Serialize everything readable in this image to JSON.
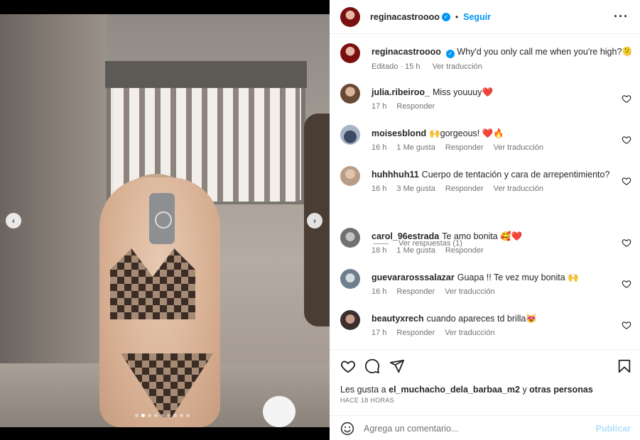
{
  "header": {
    "username": "reginacastroooo",
    "follow_label": "Seguir",
    "bullet": "•",
    "more_label": "•••"
  },
  "caption": {
    "username": "reginacastroooo",
    "text": "Why'd you only call me when you're high?🫠",
    "edited": "Editado",
    "time": "15 h",
    "translate": "Ver traducción"
  },
  "comments": [
    {
      "username": "julia.ribeiroo_",
      "text": "Miss youuuy❤️",
      "time": "17 h",
      "likes": "",
      "reply": "Responder",
      "translate": ""
    },
    {
      "username": "moisesblond",
      "text": "🙌gorgeous! ❤️🔥",
      "time": "16 h",
      "likes": "1 Me gusta",
      "reply": "Responder",
      "translate": "Ver traducción"
    },
    {
      "username": "huhhhuh11",
      "text": "Cuerpo de tentación y cara de arrepentimiento?",
      "time": "16 h",
      "likes": "3 Me gusta",
      "reply": "Responder",
      "translate": "Ver traducción"
    },
    {
      "username": "carol_96estrada",
      "text": "Te amo bonita 🥰❤️",
      "time": "18 h",
      "likes": "1 Me gusta",
      "reply": "Responder",
      "translate": ""
    },
    {
      "username": "guevararosssalazar",
      "text": "Guapa !! Te vez muy bonita 🙌",
      "time": "16 h",
      "likes": "",
      "reply": "Responder",
      "translate": "Ver traducción"
    },
    {
      "username": "beautyxrech",
      "text": "cuando apareces td brilla😻",
      "time": "17 h",
      "likes": "",
      "reply": "Responder",
      "translate": "Ver traducción"
    }
  ],
  "view_replies": "Ver respuestas (1)",
  "likes_line": {
    "prefix": "Les gusta a",
    "user": "el_muchacho_dela_barbaa_m2",
    "middle": "y",
    "suffix": "otras personas"
  },
  "post_time": "HACE 18 HORAS",
  "composer": {
    "placeholder": "Agrega un comentario...",
    "post_label": "Publicar"
  },
  "carousel": {
    "total_slides": 9,
    "active_slide": 2
  },
  "colors": {
    "accent": "#0095f6",
    "heart_red": "#ed4956",
    "post_disabled": "#b2dffc"
  }
}
